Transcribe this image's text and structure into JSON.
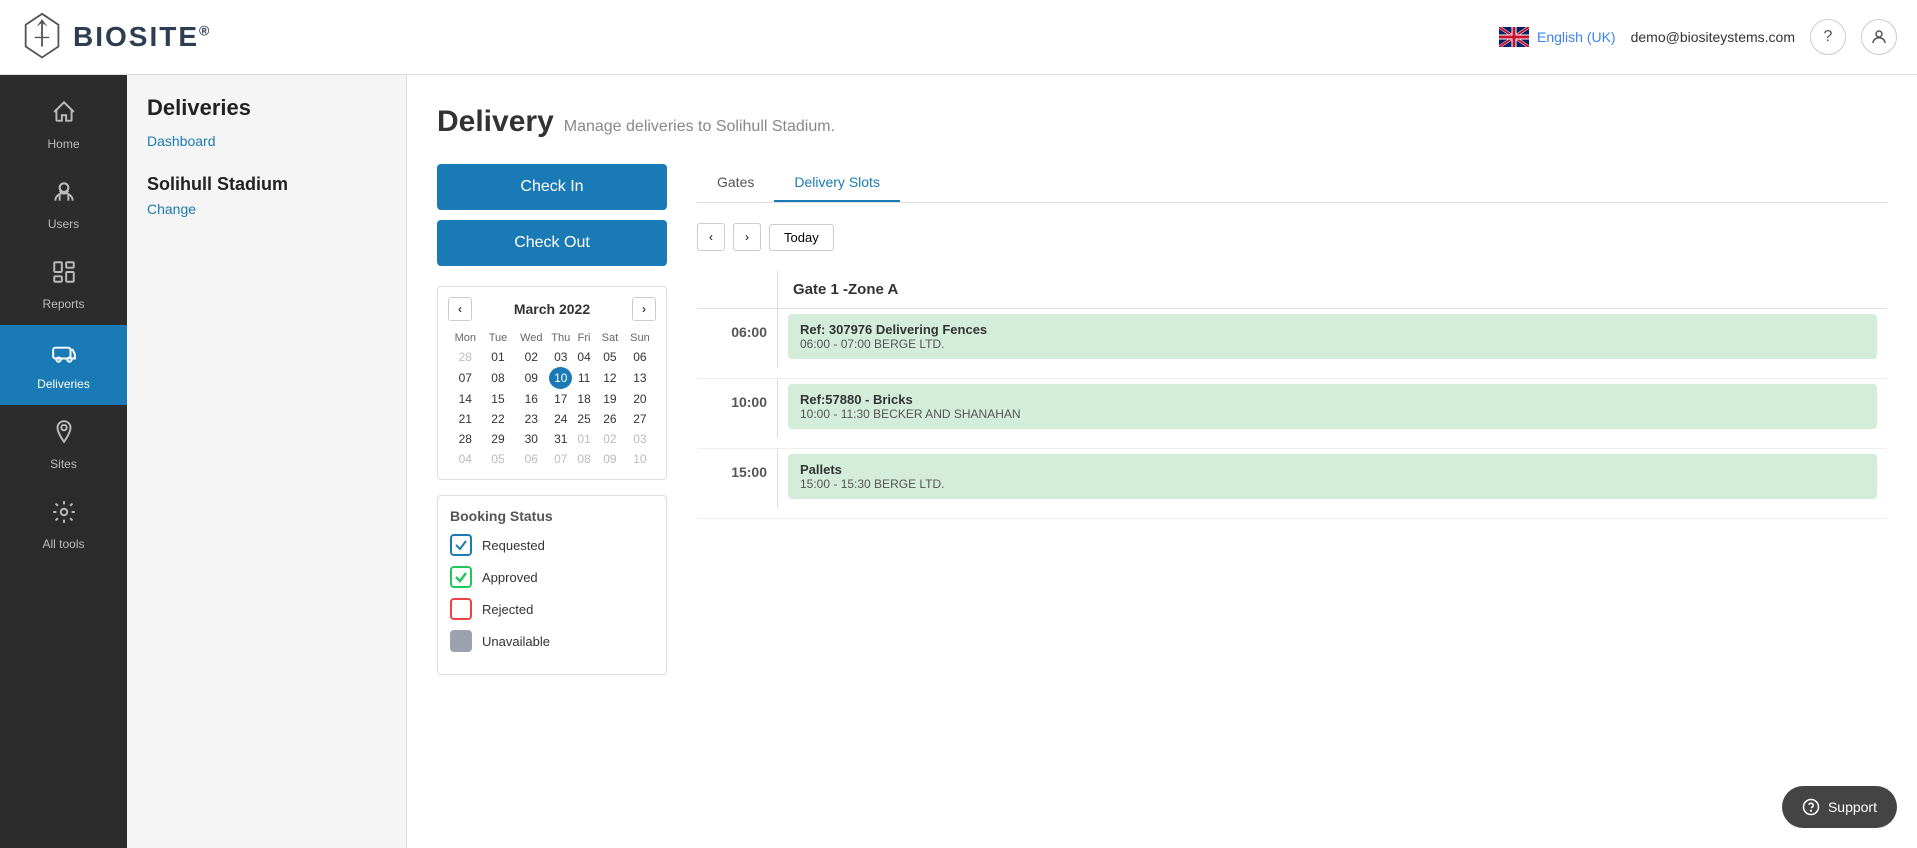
{
  "header": {
    "logo_text": "BIOSITE",
    "logo_reg": "®",
    "language": "English (UK)",
    "user_email": "demo@biositeystems.com",
    "help_icon": "?",
    "user_icon": "👤"
  },
  "sidebar_nav": {
    "items": [
      {
        "id": "home",
        "label": "Home",
        "icon": "🏠",
        "active": false
      },
      {
        "id": "users",
        "label": "Users",
        "icon": "👷",
        "active": false
      },
      {
        "id": "reports",
        "label": "Reports",
        "icon": "📊",
        "active": false
      },
      {
        "id": "deliveries",
        "label": "Deliveries",
        "icon": "🚌",
        "active": true
      },
      {
        "id": "sites",
        "label": "Sites",
        "icon": "📍",
        "active": false
      },
      {
        "id": "all-tools",
        "label": "All tools",
        "icon": "⚙",
        "active": false
      }
    ]
  },
  "secondary_sidebar": {
    "title": "Deliveries",
    "dashboard_link": "Dashboard",
    "site_name": "Solihull Stadium",
    "change_link": "Change"
  },
  "page": {
    "title": "Delivery",
    "subtitle": "Manage deliveries to Solihull Stadium."
  },
  "action_buttons": {
    "check_in": "Check In",
    "check_out": "Check Out"
  },
  "calendar": {
    "month_year": "March 2022",
    "days_header": [
      "Mon",
      "Tue",
      "Wed",
      "Thu",
      "Fri",
      "Sat",
      "Sun"
    ],
    "weeks": [
      [
        "28",
        "01",
        "02",
        "03",
        "04",
        "05",
        "06"
      ],
      [
        "07",
        "08",
        "09",
        "10",
        "11",
        "12",
        "13"
      ],
      [
        "14",
        "15",
        "16",
        "17",
        "18",
        "19",
        "20"
      ],
      [
        "21",
        "22",
        "23",
        "24",
        "25",
        "26",
        "27"
      ],
      [
        "28",
        "29",
        "30",
        "31",
        "01",
        "02",
        "03"
      ],
      [
        "04",
        "05",
        "06",
        "07",
        "08",
        "09",
        "10"
      ]
    ],
    "today_day": "10",
    "today_row": 1,
    "today_col": 3,
    "other_month_days": [
      "28",
      "01",
      "02",
      "03",
      "04",
      "05",
      "06",
      "01",
      "02",
      "03",
      "04",
      "05",
      "06",
      "07",
      "08",
      "09",
      "10"
    ]
  },
  "booking_status": {
    "title": "Booking Status",
    "items": [
      {
        "id": "requested",
        "label": "Requested",
        "type": "requested"
      },
      {
        "id": "approved",
        "label": "Approved",
        "type": "approved"
      },
      {
        "id": "rejected",
        "label": "Rejected",
        "type": "rejected"
      },
      {
        "id": "unavailable",
        "label": "Unavailable",
        "type": "unavailable"
      }
    ]
  },
  "schedule": {
    "tabs": [
      {
        "id": "gates",
        "label": "Gates",
        "active": false
      },
      {
        "id": "delivery-slots",
        "label": "Delivery Slots",
        "active": true
      }
    ],
    "gate_name": "Gate 1 -Zone A",
    "slots": [
      {
        "time": "06:00",
        "title": "Ref: 307976 Delivering Fences",
        "slot_time": "06:00 - 07:00 BERGE LTD."
      },
      {
        "time": "10:00",
        "title": "Ref:57880 - Bricks",
        "slot_time": "10:00 - 11:30 BECKER AND SHANAHAN"
      },
      {
        "time": "15:00",
        "title": "Pallets",
        "slot_time": "15:00 - 15:30 BERGE LTD."
      }
    ],
    "today_btn": "Today"
  },
  "support": {
    "label": "Support",
    "icon": "💬"
  }
}
